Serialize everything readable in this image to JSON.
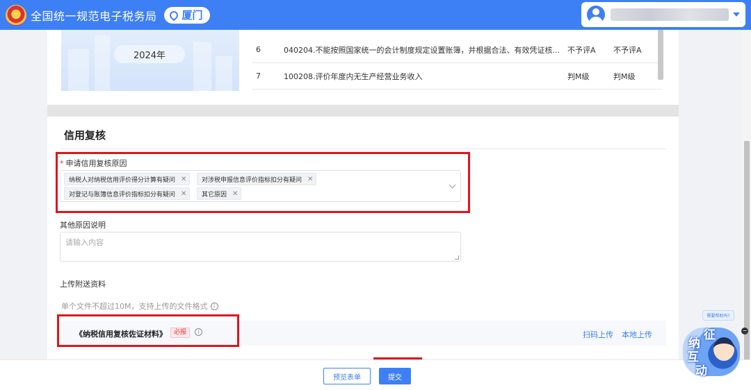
{
  "header": {
    "title": "全国统一规范电子税务局",
    "city": "厦门"
  },
  "year_panel": {
    "year": "2024年"
  },
  "rules": [
    {
      "no": "6",
      "desc": "040204.不能按照国家统一的会计制度规定设置账簿，并根据合法、有效凭证核...",
      "col1": "不予评A",
      "col2": "不予评A"
    },
    {
      "no": "7",
      "desc": "100208.评价年度内无生产经营业务收入",
      "col1": "判M级",
      "col2": "判M级"
    }
  ],
  "credit_review": {
    "section_title": "信用复核",
    "reason_label": "申请信用复核原因",
    "reason_tags": [
      "纳税人对纳税信用评价得分计算有疑问",
      "对涉税申报信息评价指标扣分有疑问",
      "对登记与账簿信息评价指标扣分有疑问",
      "其它原因"
    ],
    "other_label": "其他原因说明",
    "other_placeholder": "请输入内容",
    "upload_label": "上传附送资料",
    "upload_hint": "单个文件不超过10M，支持上传的文件格式",
    "document": {
      "name": "《纳税信用复核佐证材料》",
      "badge": "必报",
      "scan_upload": "扫码上传",
      "local_upload": "本地上传"
    }
  },
  "footer": {
    "preview_label": "预览表单",
    "submit_label": "提交"
  },
  "assistant": {
    "bubble": "需要帮助吗?",
    "chars": [
      "征",
      "纳",
      "互",
      "动"
    ]
  }
}
